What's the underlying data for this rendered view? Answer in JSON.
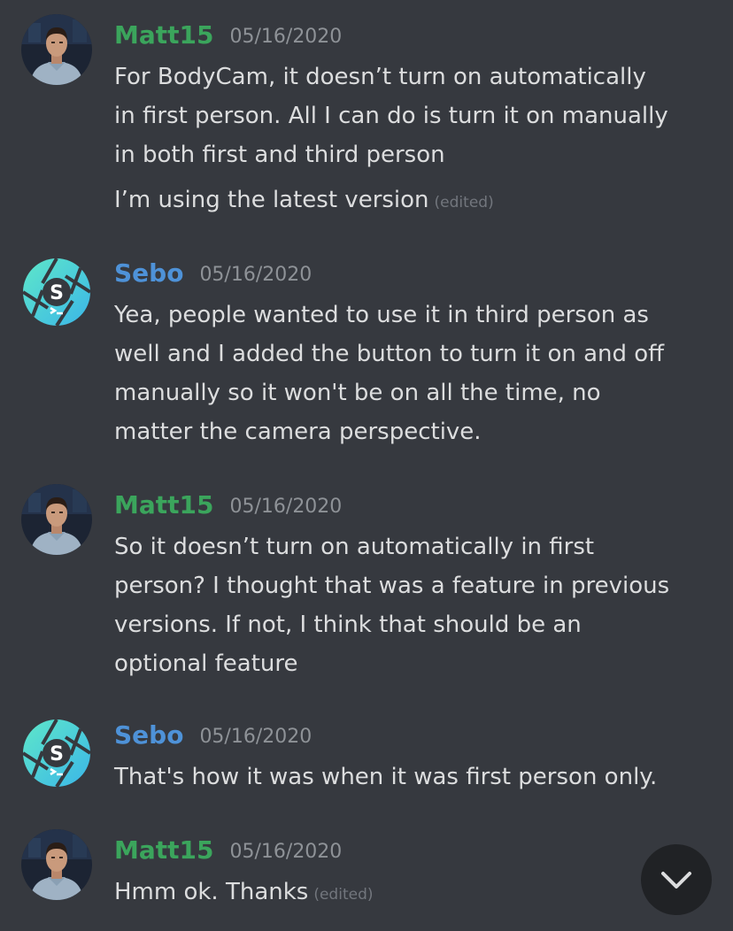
{
  "colors": {
    "background": "#36393f",
    "text": "#dcddde",
    "timestamp": "#8e9297",
    "edited": "#72767d",
    "matt_name": "#3ba55c",
    "sebo_name": "#4e92d8",
    "scroll_button_bg": "#202225"
  },
  "users": {
    "matt": {
      "name": "Matt15",
      "avatar_icon": "man-portrait-icon"
    },
    "sebo": {
      "name": "Sebo",
      "avatar_icon": "shutter-logo-icon"
    }
  },
  "messages": [
    {
      "author": "Matt15",
      "timestamp": "05/16/2020",
      "lines": [
        "For BodyCam, it doesn’t turn on automatically",
        "in first person. All I can do is turn it on manually",
        "in both first and third person"
      ],
      "followup": {
        "text": "I’m using the latest version",
        "edited_label": "(edited)"
      }
    },
    {
      "author": "Sebo",
      "timestamp": "05/16/2020",
      "lines": [
        "Yea, people wanted to use it in third person as",
        "well and I added the button to turn it on and off",
        "manually so it won't be on all the time, no",
        "matter the camera perspective."
      ]
    },
    {
      "author": "Matt15",
      "timestamp": "05/16/2020",
      "lines": [
        "So it doesn’t turn on automatically in first",
        "person? I thought that was a feature in previous",
        "versions. If not, I think that should be an",
        "optional feature"
      ]
    },
    {
      "author": "Sebo",
      "timestamp": "05/16/2020",
      "lines": [
        "That's how it was when it was first person only."
      ]
    },
    {
      "author": "Matt15",
      "timestamp": "05/16/2020",
      "lines": [
        "Hmm ok. Thanks"
      ],
      "edited_label": "(edited)"
    }
  ],
  "scroll_button": {
    "icon": "chevron-down-icon"
  }
}
